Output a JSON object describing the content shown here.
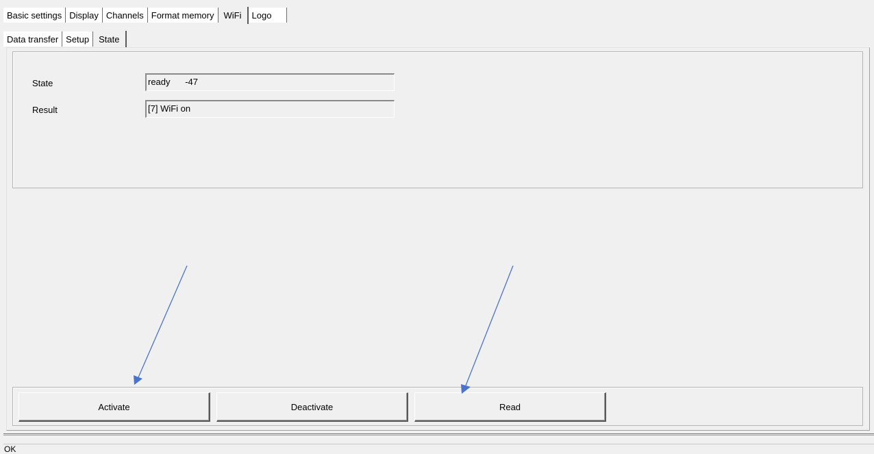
{
  "main_tabs": [
    {
      "label": "Basic settings"
    },
    {
      "label": "Display"
    },
    {
      "label": "Channels"
    },
    {
      "label": "Format memory"
    },
    {
      "label": "WiFi",
      "active": true
    },
    {
      "label": "Logo"
    }
  ],
  "sub_tabs": [
    {
      "label": "Data transfer"
    },
    {
      "label": "Setup"
    },
    {
      "label": "State",
      "active": true
    }
  ],
  "fields": {
    "state": {
      "label": "State",
      "value": "ready      -47"
    },
    "result": {
      "label": "Result",
      "value": "[7] WiFi on"
    }
  },
  "buttons": {
    "activate": "Activate",
    "deactivate": "Deactivate",
    "read": "Read"
  },
  "status_text": "OK",
  "colors": {
    "annotation_arrow": "#4a74c9",
    "window_background": "#f0f0f0"
  }
}
